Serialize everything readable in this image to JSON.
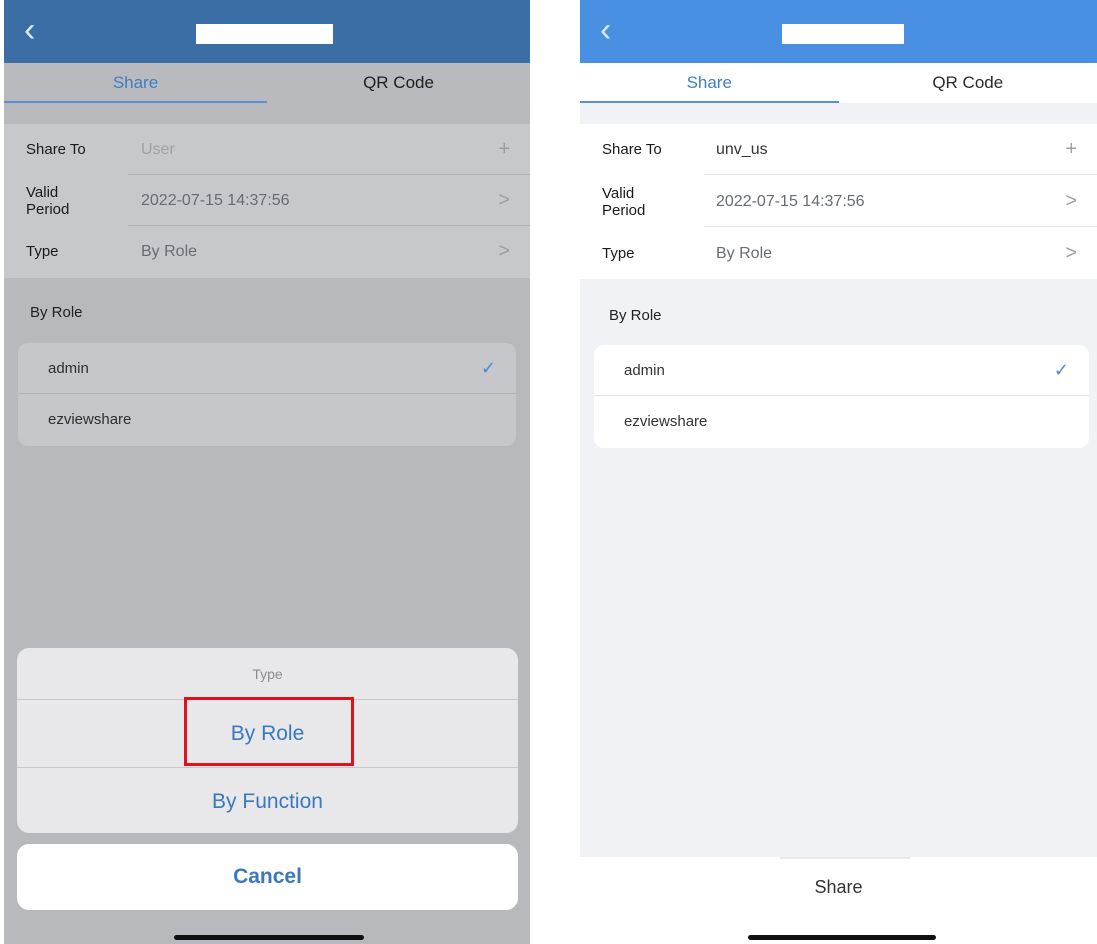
{
  "left": {
    "nav": {
      "back": "‹"
    },
    "tabs": [
      "Share",
      "QR Code"
    ],
    "form": {
      "share_to": {
        "label": "Share To",
        "value": "User",
        "trail": "+"
      },
      "valid_period": {
        "label": "Valid\nPeriod",
        "value": "2022-07-15 14:37:56",
        "trail": ">"
      },
      "type": {
        "label": "Type",
        "value": "By Role",
        "trail": ">"
      }
    },
    "section_label": "By Role",
    "roles": [
      {
        "name": "admin",
        "check": "✓"
      },
      {
        "name": "ezviewshare"
      }
    ],
    "sheet": {
      "title": "Type",
      "options": [
        "By Role",
        "By Function"
      ],
      "cancel": "Cancel"
    }
  },
  "right": {
    "nav": {
      "back": "‹"
    },
    "tabs": [
      "Share",
      "QR Code"
    ],
    "form": {
      "share_to": {
        "label": "Share To",
        "value": "unv_us",
        "trail": "+"
      },
      "valid_period": {
        "label": "Valid\nPeriod",
        "value": "2022-07-15 14:37:56",
        "trail": ">"
      },
      "type": {
        "label": "Type",
        "value": "By Role",
        "trail": ">"
      }
    },
    "section_label": "By Role",
    "roles": [
      {
        "name": "admin",
        "check": "✓"
      },
      {
        "name": "ezviewshare"
      }
    ],
    "share_button": "Share"
  }
}
